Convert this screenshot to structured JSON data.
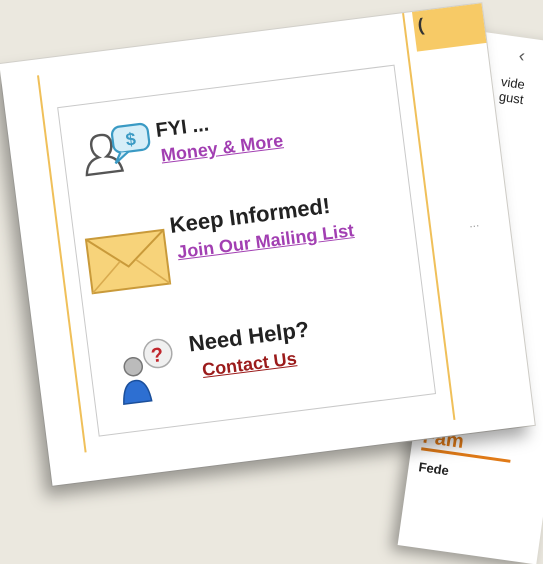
{
  "panel": {
    "items": [
      {
        "title": "FYI ...",
        "link": "Money & More",
        "icon": "money-chat-icon",
        "link_color": "#a23fb2"
      },
      {
        "title": "Keep Informed!",
        "link": "Join Our Mailing List",
        "icon": "envelope-icon",
        "link_color": "#a23fb2"
      },
      {
        "title": "Need Help?",
        "link": "Contact Us",
        "icon": "support-person-icon",
        "link_color": "#9b1b1b"
      }
    ]
  },
  "background_page": {
    "snippets": [
      "vide",
      "gust"
    ],
    "orange_fragments": [
      "e",
      "e"
    ],
    "small_fragments": [
      "Y",
      "a"
    ],
    "footer_heading": "Fam",
    "footer_text": "Fede"
  },
  "colors": {
    "accent_rule": "#f0c05a",
    "orange": "#e07a17"
  }
}
